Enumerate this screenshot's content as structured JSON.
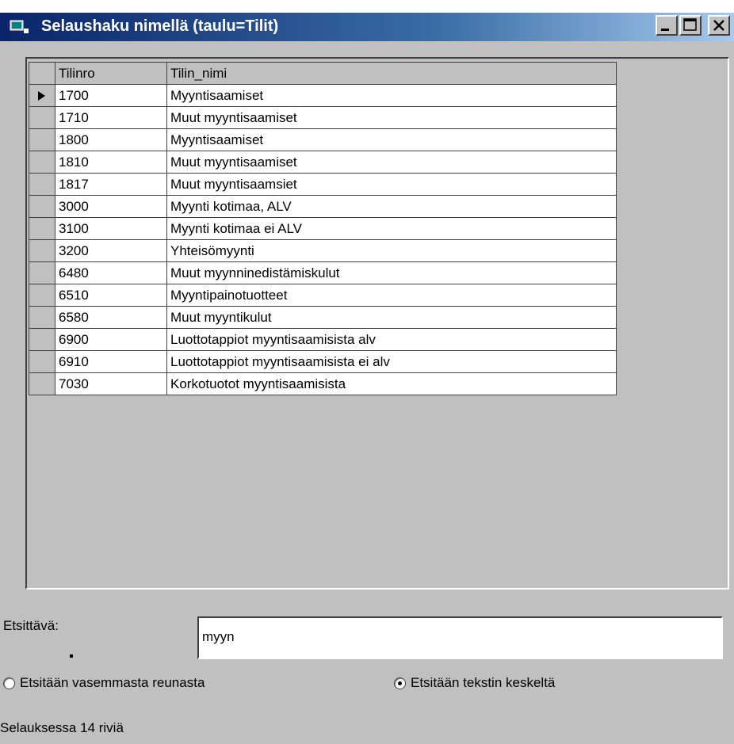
{
  "window": {
    "title": "Selaushaku nimellä (taulu=Tilit)"
  },
  "grid": {
    "headers": [
      "Tilinro",
      "Tilin_nimi"
    ],
    "rows": [
      [
        "1700",
        "Myyntisaamiset"
      ],
      [
        "1710",
        "Muut myyntisaamiset"
      ],
      [
        "1800",
        "Myyntisaamiset"
      ],
      [
        "1810",
        "Muut myyntisaamiset"
      ],
      [
        "1817",
        "Muut myyntisaamsiet"
      ],
      [
        "3000",
        "Myynti kotimaa, ALV"
      ],
      [
        "3100",
        "Myynti kotimaa ei ALV"
      ],
      [
        "3200",
        "Yhteisömyynti"
      ],
      [
        "6480",
        "Muut myynninedistämiskulut"
      ],
      [
        "6510",
        "Myyntipainotuotteet"
      ],
      [
        "6580",
        "Muut myyntikulut"
      ],
      [
        "6900",
        "Luottotappiot myyntisaamisista alv"
      ],
      [
        "6910",
        "Luottotappiot myyntisaamisista ei alv"
      ],
      [
        "7030",
        "Korkotuotot myyntisaamisista"
      ]
    ]
  },
  "search": {
    "label": "Etsittävä:",
    "value": "myyn"
  },
  "options": {
    "left": "Etsitään vasemmasta reunasta",
    "middle": "Etsitään tekstin keskeltä"
  },
  "status": "Selauksessa 14 riviä"
}
